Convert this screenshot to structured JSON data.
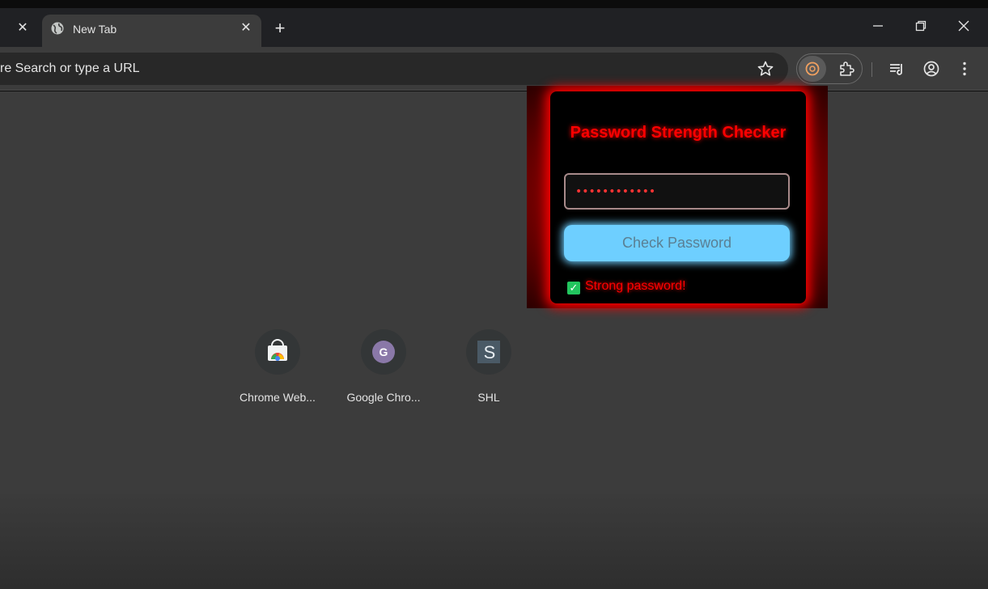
{
  "tabs": {
    "active_title": "New Tab"
  },
  "omnibox": {
    "text": "re Search or type a URL"
  },
  "shortcuts": [
    {
      "label": "Chrome Web...",
      "icon": "chrome-web-store-icon"
    },
    {
      "label": "Google Chro...",
      "icon": "google-chrome-icon",
      "glyph": "G"
    },
    {
      "label": "SHL",
      "icon": "shl-icon",
      "glyph": "S"
    }
  ],
  "popup": {
    "title": "Password Strength Checker",
    "password_value": "••••••••••••",
    "button_label": "Check Password",
    "result_text": "Strong password!",
    "result_mark": "✓"
  },
  "colors": {
    "accent_red": "#ff0000",
    "button_blue": "#6ecfff",
    "check_green": "#22c55e"
  }
}
